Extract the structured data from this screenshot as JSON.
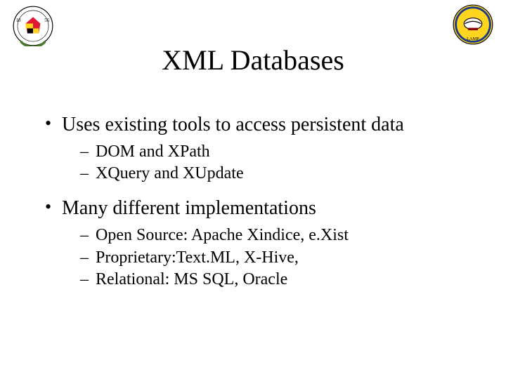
{
  "title": "XML Databases",
  "bullets": [
    {
      "text": "Uses existing tools to access persistent data",
      "sub": [
        "DOM and XPath",
        "XQuery and XUpdate"
      ]
    },
    {
      "text": "Many different implementations",
      "sub": [
        "Open Source: Apache Xindice, e.Xist",
        "Proprietary:Text.ML, X-Hive,",
        "Relational: MS SQL, Oracle"
      ]
    }
  ],
  "logos": {
    "left": "university-of-maryland-seal",
    "right": "lamp-badge"
  }
}
